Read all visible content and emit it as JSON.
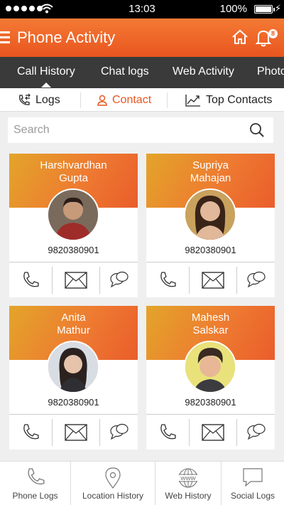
{
  "status_bar": {
    "time": "13:03",
    "battery": "100%"
  },
  "header": {
    "title": "Phone Activity",
    "notification_count": "8"
  },
  "tabs": [
    {
      "label": "Call History",
      "active": true
    },
    {
      "label": "Chat logs"
    },
    {
      "label": "Web Activity"
    },
    {
      "label": "Photo"
    }
  ],
  "subtabs": [
    {
      "label": "Logs"
    },
    {
      "label": "Contact",
      "active": true
    },
    {
      "label": "Top Contacts"
    }
  ],
  "search": {
    "placeholder": "Search"
  },
  "contacts": [
    {
      "first": "Harshvardhan",
      "last": "Gupta",
      "phone": "9820380901"
    },
    {
      "first": "Supriya",
      "last": "Mahajan",
      "phone": "9820380901"
    },
    {
      "first": "Anita",
      "last": "Mathur",
      "phone": "9820380901"
    },
    {
      "first": "Mahesh",
      "last": "Salskar",
      "phone": "9820380901"
    }
  ],
  "bottom_nav": [
    {
      "label": "Phone Logs",
      "icon": "phone-icon"
    },
    {
      "label": "Location History",
      "icon": "location-pin-icon"
    },
    {
      "label": "Web History",
      "icon": "globe-icon"
    },
    {
      "label": "Social Logs",
      "icon": "speech-bubble-icon"
    }
  ],
  "colors": {
    "accent": "#e9551f",
    "tab_bar": "#3a3a3a"
  }
}
